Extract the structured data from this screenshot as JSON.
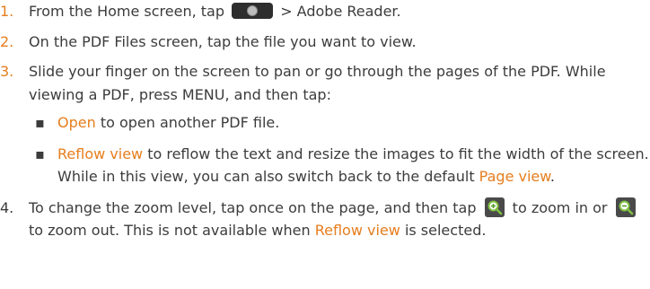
{
  "steps": [
    {
      "number": "1.",
      "parts": {
        "a": "From the Home screen, tap",
        "b": "> Adobe Reader."
      }
    },
    {
      "number": "2.",
      "text": "On the PDF Files screen, tap the file you want to view."
    },
    {
      "number": "3.",
      "text": "Slide your finger on the screen to pan or go through the pages of the PDF. While viewing a PDF, press MENU, and then tap:",
      "sub_items": [
        {
          "highlight": "Open",
          "rest": " to open another PDF file."
        },
        {
          "highlight": "Reflow view",
          "rest": " to reflow the text and resize the images to fit the width of the screen. While in this view, you can also switch back to the default ",
          "highlight2": "Page view",
          "end": "."
        }
      ]
    },
    {
      "number": "4.",
      "parts": {
        "a": "To change the zoom level, tap once on the page, and then tap",
        "b": "to zoom in or",
        "c": "to zoom out. This is not available when",
        "d": "Reflow view",
        "e": "is selected."
      }
    }
  ],
  "colors": {
    "text": "#3c3c3c",
    "accent": "#e67e1e"
  },
  "icons": {
    "home_key": "camera-key-icon",
    "zoom_in": "zoom-in-icon",
    "zoom_out": "zoom-out-icon"
  }
}
